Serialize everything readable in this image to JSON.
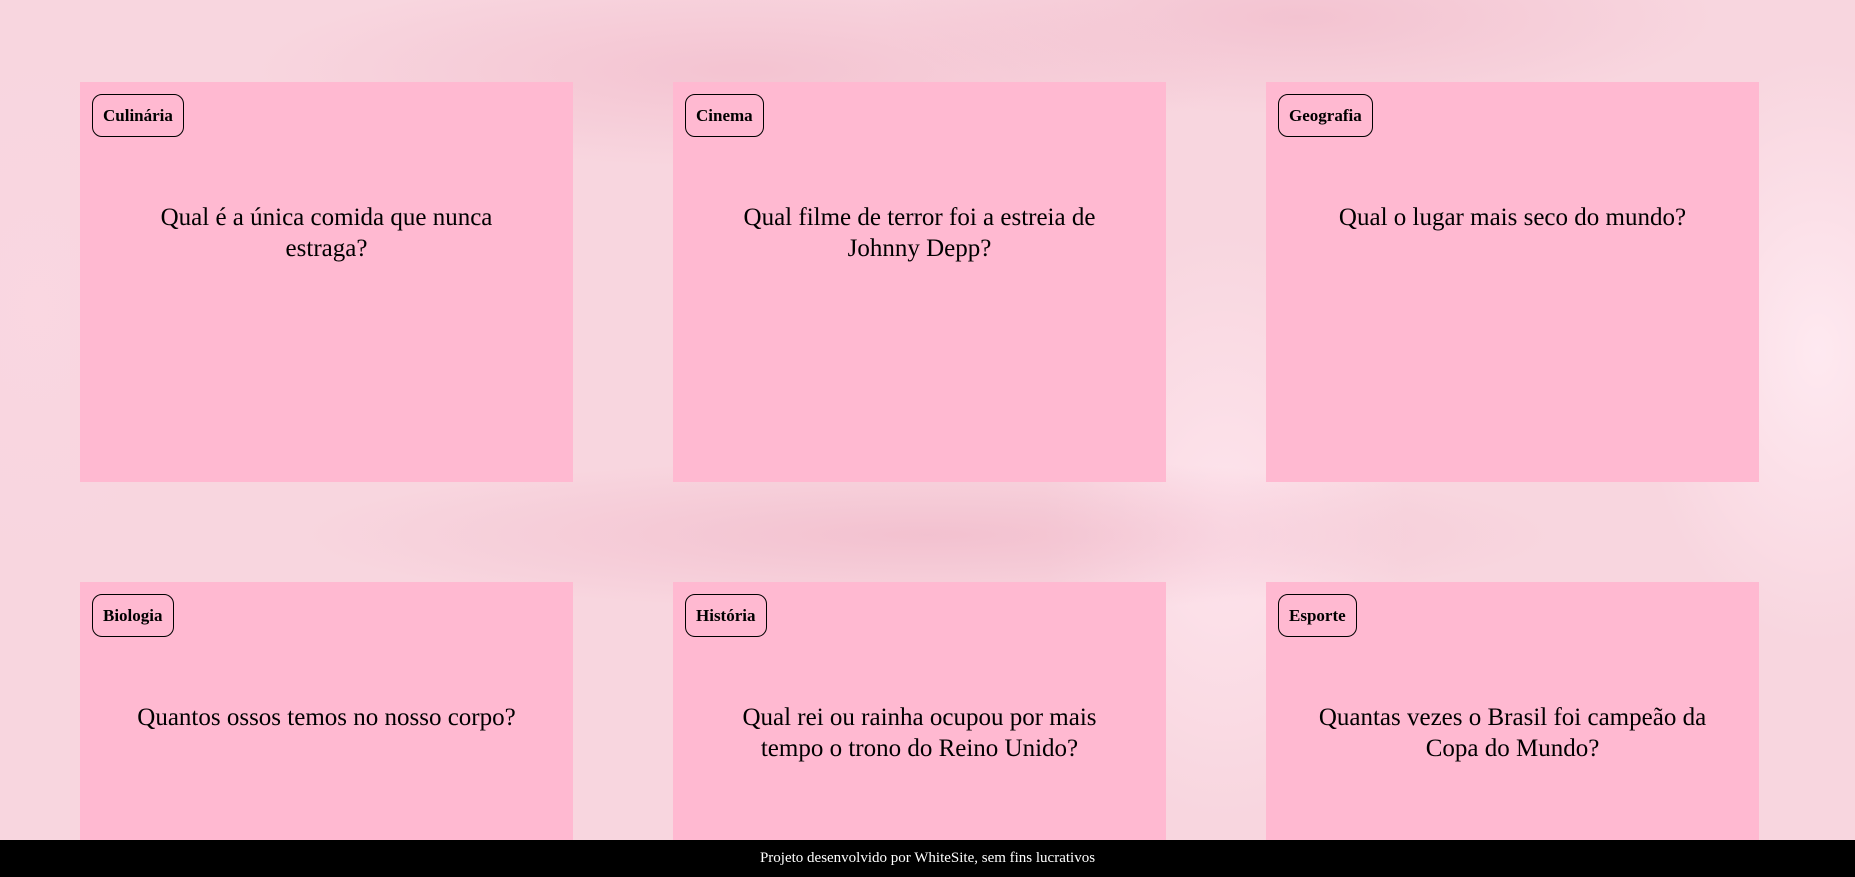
{
  "cards": [
    {
      "category": "Culinária",
      "question": "Qual é a única comida que nunca estraga?"
    },
    {
      "category": "Cinema",
      "question": "Qual filme de terror foi a estreia de Johnny Depp?"
    },
    {
      "category": "Geografia",
      "question": "Qual o lugar mais seco do mundo?"
    },
    {
      "category": "Biologia",
      "question": "Quantos ossos temos no nosso corpo?"
    },
    {
      "category": "História",
      "question": "Qual rei ou rainha ocupou por mais tempo o trono do Reino Unido?"
    },
    {
      "category": "Esporte",
      "question": "Quantas vezes o Brasil foi campeão da Copa do Mundo?"
    }
  ],
  "footer": {
    "text": "Projeto desenvolvido por WhiteSite, sem fins lucrativos"
  },
  "colors": {
    "card_background": "#ffb9d1",
    "page_background": "#f8d6df",
    "footer_background": "#000000"
  }
}
